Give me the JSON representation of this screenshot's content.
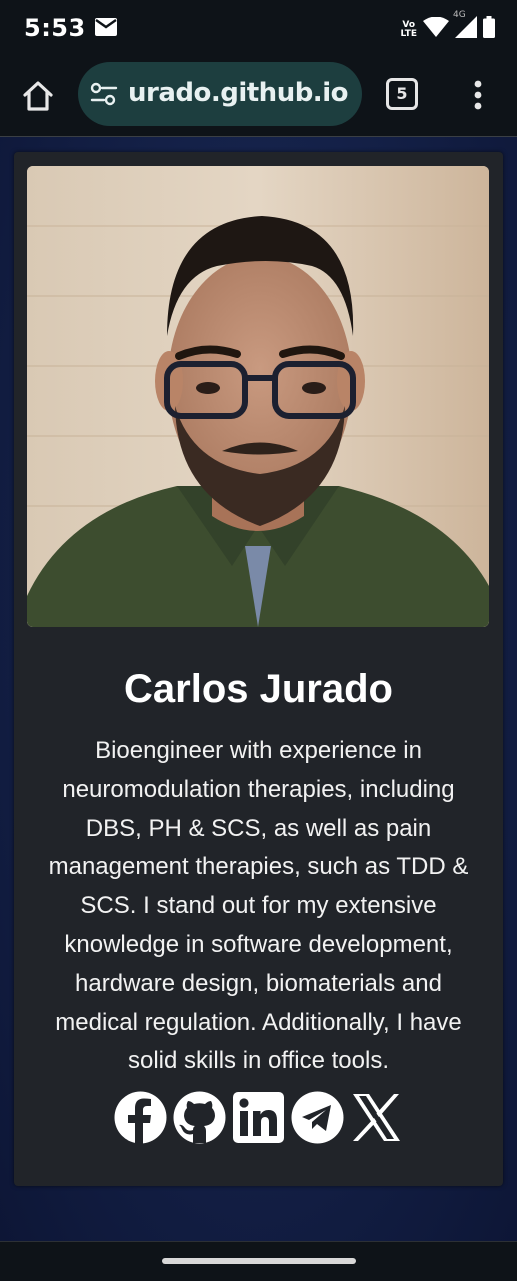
{
  "status_bar": {
    "time": "5:53",
    "volte_top": "Vo",
    "volte_bottom": "LTE",
    "network": "4G",
    "icons": [
      "mail-icon",
      "volte-icon",
      "wifi-icon",
      "signal-icon",
      "battery-icon"
    ]
  },
  "browser": {
    "url": "urado.github.io",
    "tab_count": "5",
    "icons": [
      "home-icon",
      "site-settings-icon",
      "tabs-icon",
      "more-menu-icon"
    ]
  },
  "profile": {
    "name": "Carlos Jurado",
    "bio": "Bioengineer with experience in neuromodulation therapies, including DBS, PH & SCS, as well as pain management therapies, such as TDD & SCS. I stand out for my extensive knowledge in software development, hardware design, biomaterials and medical regulation. Additionally, I have solid skills in office tools.",
    "social": [
      "facebook-icon",
      "github-icon",
      "linkedin-icon",
      "telegram-icon",
      "x-icon"
    ]
  },
  "colors": {
    "card": "#212429",
    "page_background": "#15224a",
    "url_bar": "#1d3e3f"
  }
}
